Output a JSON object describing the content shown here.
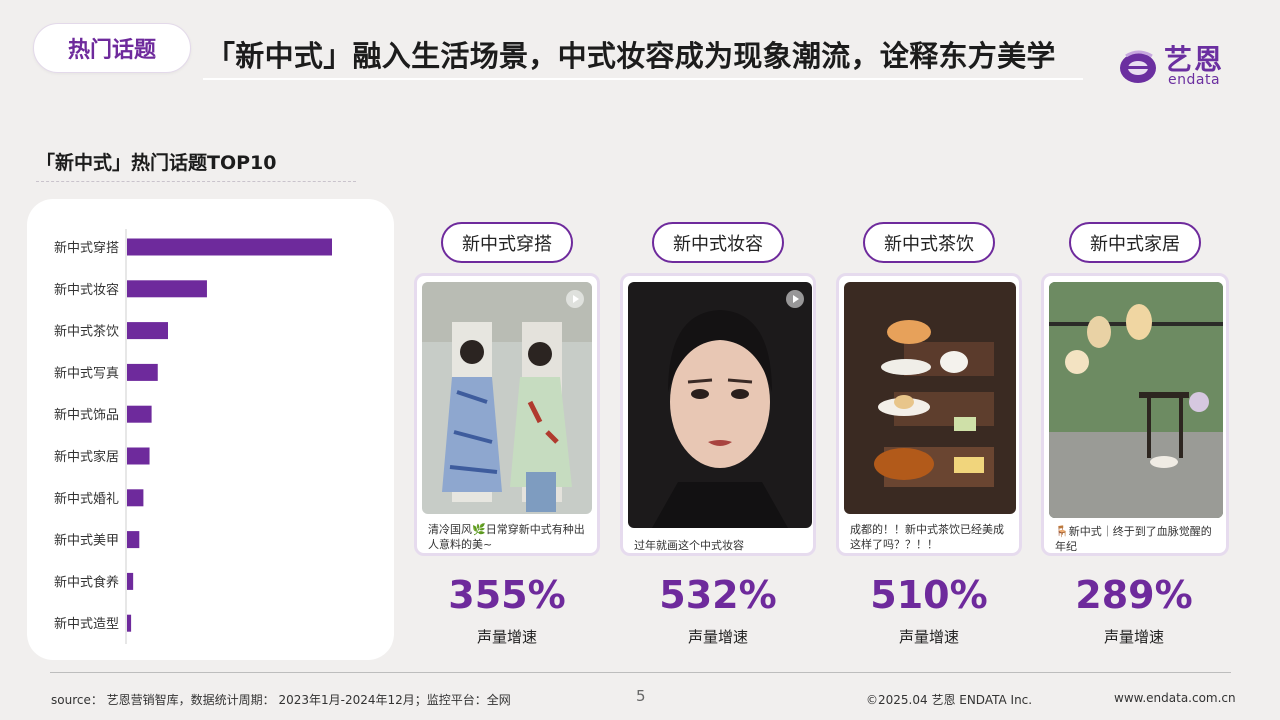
{
  "header": {
    "tag": "热门话题",
    "title": "「新中式」融入生活场景，中式妆容成为现象潮流，诠释东方美学",
    "logo_cn": "艺恩",
    "logo_en": "endata"
  },
  "section": {
    "subtitle": "「新中式」热门话题TOP10"
  },
  "chart_data": {
    "type": "bar",
    "orientation": "horizontal",
    "title": "「新中式」热门话题TOP10",
    "categories": [
      "新中式穿搭",
      "新中式妆容",
      "新中式茶饮",
      "新中式写真",
      "新中式饰品",
      "新中式家居",
      "新中式婚礼",
      "新中式美甲",
      "新中式食养",
      "新中式造型"
    ],
    "values": [
      100,
      39,
      20,
      15,
      12,
      11,
      8,
      6,
      3,
      2
    ],
    "axis_labels_visible": false,
    "bar_color": "#6e2a9c"
  },
  "cards": [
    {
      "category": "新中式穿搭",
      "caption": [
        "清冷国风🌿日常穿新中式有种出",
        "人意料的美~"
      ],
      "growth": "355%",
      "growth_label": "声量增速"
    },
    {
      "category": "新中式妆容",
      "caption": [
        "过年就画这个中式妆容"
      ],
      "growth": "532%",
      "growth_label": "声量增速"
    },
    {
      "category": "新中式茶饮",
      "caption": [
        "成都的！！新中式茶饮已经美成",
        "这样了吗？？！！"
      ],
      "growth": "510%",
      "growth_label": "声量增速"
    },
    {
      "category": "新中式家居",
      "caption": [
        "🪑新中式｜终于到了血脉觉醒的",
        "年纪"
      ],
      "growth": "289%",
      "growth_label": "声量增速"
    }
  ],
  "footer": {
    "source": "source： 艺恩营销智库，数据统计周期： 2023年1月-2024年12月；监控平台：全网",
    "page": "5",
    "copyright": "©2025.04  艺恩 ENDATA Inc.",
    "url": "www.endata.com.cn"
  },
  "colors": {
    "accent": "#6e2a9c",
    "background": "#f1efee"
  }
}
